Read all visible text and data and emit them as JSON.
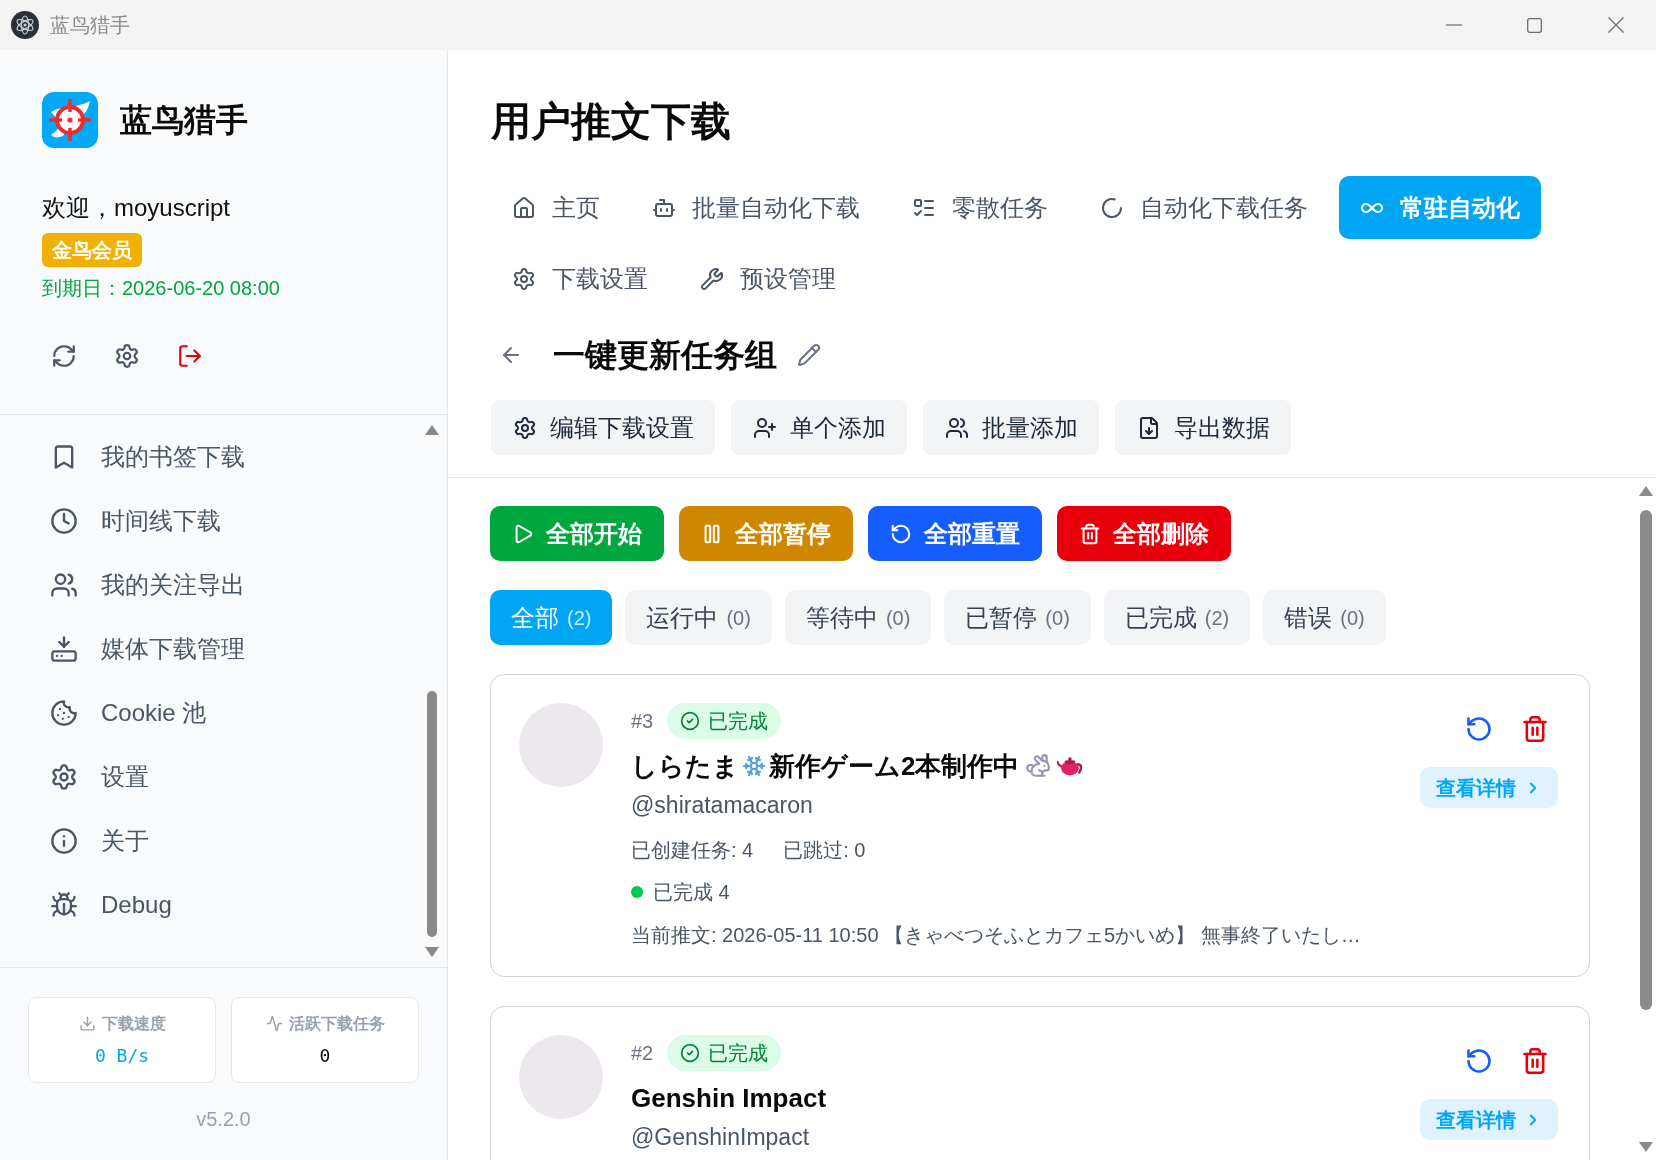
{
  "window": {
    "title": "蓝鸟猎手"
  },
  "sidebar": {
    "app_name": "蓝鸟猎手",
    "welcome": "欢迎，moyuscript",
    "badge": "金鸟会员",
    "expiry": "到期日：2026-06-20 08:00",
    "nav_items": [
      {
        "label": "我的书签下载",
        "kind": "bookmark"
      },
      {
        "label": "时间线下载",
        "kind": "clock"
      },
      {
        "label": "我的关注导出",
        "kind": "users"
      },
      {
        "label": "媒体下载管理",
        "kind": "tray"
      },
      {
        "label": "Cookie 池",
        "kind": "cookie"
      },
      {
        "label": "设置",
        "kind": "gear"
      },
      {
        "label": "关于",
        "kind": "info"
      },
      {
        "label": "Debug",
        "kind": "bug"
      }
    ],
    "stats": [
      {
        "label": "下载速度",
        "value": "0 B/s",
        "kind": "speed"
      },
      {
        "label": "活跃下载任务",
        "value": "0",
        "kind": "active"
      }
    ],
    "version": "v5.2.0"
  },
  "main": {
    "title": "用户推文下载",
    "tabs": [
      {
        "label": "主页",
        "kind": "home",
        "selected": false
      },
      {
        "label": "批量自动化下载",
        "kind": "bot",
        "selected": false
      },
      {
        "label": "零散任务",
        "kind": "list",
        "selected": false
      },
      {
        "label": "自动化下载任务",
        "kind": "loader",
        "selected": false
      },
      {
        "label": "常驻自动化",
        "kind": "infinity",
        "selected": true
      },
      {
        "label": "下载设置",
        "kind": "gear",
        "selected": false
      },
      {
        "label": "预设管理",
        "kind": "wrench",
        "selected": false
      }
    ],
    "group": {
      "title": "一键更新任务组"
    },
    "group_actions": [
      {
        "label": "编辑下载设置",
        "kind": "gear"
      },
      {
        "label": "单个添加",
        "kind": "adduser"
      },
      {
        "label": "批量添加",
        "kind": "users"
      },
      {
        "label": "导出数据",
        "kind": "export"
      }
    ],
    "bulk_actions": [
      {
        "label": "全部开始",
        "kind": "start"
      },
      {
        "label": "全部暂停",
        "kind": "pause"
      },
      {
        "label": "全部重置",
        "kind": "reset"
      },
      {
        "label": "全部删除",
        "kind": "delete"
      }
    ],
    "filters": [
      {
        "label": "全部",
        "count": "(2)",
        "selected": true
      },
      {
        "label": "运行中",
        "count": "(0)",
        "selected": false
      },
      {
        "label": "等待中",
        "count": "(0)",
        "selected": false
      },
      {
        "label": "已暂停",
        "count": "(0)",
        "selected": false
      },
      {
        "label": "已完成",
        "count": "(2)",
        "selected": false
      },
      {
        "label": "错误",
        "count": "(0)",
        "selected": false
      }
    ],
    "tasks": [
      {
        "number": "#3",
        "status": {
          "label": "已完成",
          "kind": "done"
        },
        "name": [
          {
            "kind": "text",
            "text": "しらたま"
          },
          {
            "kind": "snowflake"
          },
          {
            "kind": "text",
            "text": "新作ゲーム2本制作中"
          },
          {
            "kind": "rabbit"
          },
          {
            "kind": "teapot"
          }
        ],
        "handle": "@shiratamacaron",
        "counters": [
          "已创建任务: 4",
          "已跳过: 0"
        ],
        "progress": [
          {
            "label": "已完成 4",
            "color": "#00c950"
          }
        ],
        "current_tweet": "当前推文: 2026-05-11 10:50 【きゃべつそふとカフェ5かいめ】 無事終了いたし…",
        "details_button": "查看详情"
      },
      {
        "number": "#2",
        "status": {
          "label": "已完成",
          "kind": "done"
        },
        "name": [
          {
            "kind": "text",
            "text": "Genshin Impact"
          }
        ],
        "handle": "@GenshinImpact",
        "details_button": "查看详情"
      }
    ]
  }
}
